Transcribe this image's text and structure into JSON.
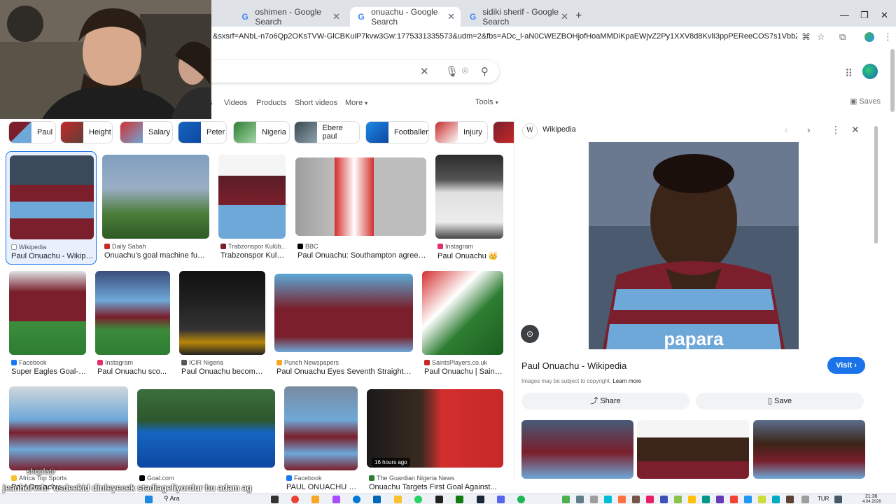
{
  "browser": {
    "tabs": [
      {
        "title": "oshimen - Google Search",
        "active": false
      },
      {
        "title": "onuachu - Google Search",
        "active": true
      },
      {
        "title": "sidiki sherif - Google Search",
        "active": false
      }
    ],
    "url": "&sxsrf=ANbL-n7o6Qp2OKsTVW-GlCBKuiP7kvw3Gw:1775331335573&udm=2&fbs=ADc_l-aN0CWEZBOHjofHoaMMDiKpaEWjvZ2Py1XXV8d8KvlI3ppPEReeCOS7s1VbbZz2TLucYQEhOXGMn-HTzeZ4mXO..."
  },
  "search": {
    "filters": [
      "s",
      "Videos",
      "Products",
      "Short videos",
      "More"
    ],
    "tools_label": "Tools",
    "saves_label": "Saves"
  },
  "chips": [
    "Paul",
    "Height",
    "Salary",
    "Peter",
    "Nigeria",
    "Ebere paul",
    "Footballer",
    "Injury"
  ],
  "results": [
    {
      "source": "Wikipedia",
      "title": "Paul Onuachu - Wikipedia"
    },
    {
      "source": "Daily Sabah",
      "title": "Onuachu's goal machine fuels ..."
    },
    {
      "source": "Trabzonspor Kulüb...",
      "title": "Trabzonspor Kulüb..."
    },
    {
      "source": "BBC",
      "title": "Paul Onuachu: Southampton agree to s..."
    },
    {
      "source": "Instagram",
      "title": "Paul Onuachu 👑"
    },
    {
      "source": "Facebook",
      "title": "Super Eagles Goal-po..."
    },
    {
      "source": "Instagram",
      "title": "Paul Onuachu sco..."
    },
    {
      "source": "ICIR Nigeria",
      "title": "Paul Onuachu becomes f..."
    },
    {
      "source": "Punch Newspapers",
      "title": "Paul Onuachu Eyes Seventh Straight Goal ..."
    },
    {
      "source": "SaintsPlayers.co.uk",
      "title": "Paul Onuachu | Saints..."
    },
    {
      "source": "Africa Top Sports",
      "title": "Paul Onuachu..."
    },
    {
      "source": "Goal.com",
      "title": ""
    },
    {
      "source": "Facebook",
      "title": "PAUL ONUACHU F1..."
    },
    {
      "source": "The Guardian Nigeria News",
      "title": "Onuachu Targets First Goal Against..."
    }
  ],
  "time_badge": "16 hours ago",
  "panel": {
    "source": "Wikipedia",
    "title": "Paul Onuachu - Wikipedia",
    "visit_label": "Visit",
    "copyright": "Images may be subject to copyright.",
    "learn_more": "Learn more",
    "share_label": "Share",
    "save_label": "Save"
  },
  "chat": {
    "line1": "shoplatir",
    "line2": "jeanhorvrh: 'usdeekid dinleyecek stadiageliyordur bu adam ag"
  },
  "taskbar": {
    "search_label": "Ara",
    "lang": "TUR",
    "time": "21:36",
    "date": "4.04.2026"
  },
  "colors": {
    "accent": "#1a73e8",
    "tab_bar": "#dfe3e8",
    "trabzon_maroon": "#7a1f2b",
    "trabzon_blue": "#6ea8d8"
  }
}
